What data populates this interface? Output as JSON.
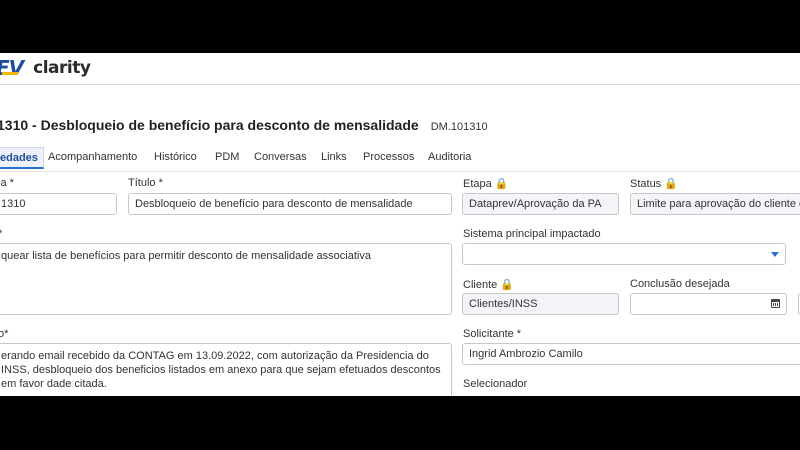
{
  "header": {
    "logo_prefix": "EV",
    "logo_name": "clarity"
  },
  "page": {
    "title": "1310 - Desbloqueio de benefício para desconto de mensalidade",
    "code": "DM.101310"
  },
  "tabs": [
    {
      "label": "edades"
    },
    {
      "label": "Acompanhamento"
    },
    {
      "label": "Histórico"
    },
    {
      "label": "PDM"
    },
    {
      "label": "Conversas"
    },
    {
      "label": "Links"
    },
    {
      "label": "Processos"
    },
    {
      "label": "Auditoria"
    }
  ],
  "form": {
    "col1": {
      "label_a": "ia *",
      "value_a": "1310",
      "label_b": "*",
      "value_b": "quear lista de benefícios para permitir desconto de mensalidade associativa",
      "label_c": "o*",
      "value_c": "erando email recebido da CONTAG em 13.09.2022, com autorização da Presidencia do INSS, desbloqueio dos beneficios listados em anexo para que sejam efetuados descontos em favor dade citada."
    },
    "titulo": {
      "label": "Título *",
      "value": "Desbloqueio de benefício para desconto de mensalidade"
    },
    "etapa": {
      "label": "Etapa 🔒",
      "value": "Dataprev/Aprovação da PA"
    },
    "status": {
      "label": "Status 🔒",
      "value": "Limite para aprovação do cliente e"
    },
    "sistema": {
      "label": "Sistema principal impactado",
      "value": ""
    },
    "cliente": {
      "label": "Cliente 🔒",
      "value": "Clientes/INSS"
    },
    "conclusao": {
      "label": "Conclusão desejada",
      "value": ""
    },
    "solicitante": {
      "label": "Solicitante *",
      "value": "Ingrid Ambrozio Camilo"
    },
    "selecionador": {
      "label": "Selecionador"
    }
  }
}
